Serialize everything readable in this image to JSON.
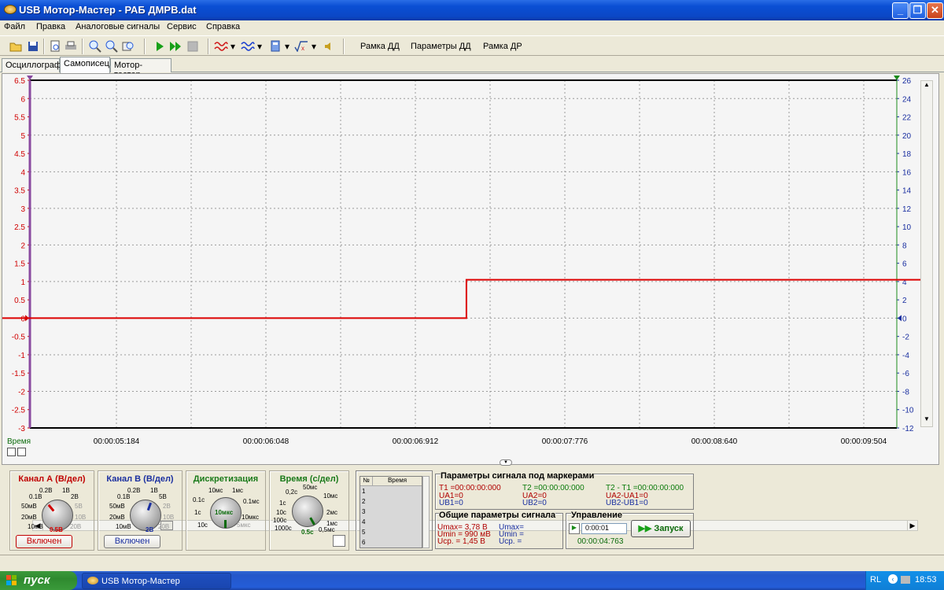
{
  "window": {
    "title": "USB Мотор-Мастер - РАБ ДМРВ.dat",
    "btn_min": "_",
    "btn_max": "❐",
    "btn_close": "✕"
  },
  "menu": [
    "Файл",
    "Правка",
    "Аналоговые сигналы",
    "Сервис",
    "Справка"
  ],
  "toolbar": {
    "labels": [
      "Рамка ДД",
      "Параметры ДД",
      "Рамка ДР"
    ]
  },
  "tabs": [
    "Осциллограф",
    "Самописец",
    "Мотор-тестер"
  ],
  "chart_data": {
    "type": "line",
    "x_label": "Время",
    "x_ticks": [
      "00:00:05:184",
      "00:00:06:048",
      "00:00:06:912",
      "00:00:07:776",
      "00:00:08:640",
      "00:00:09:504"
    ],
    "ylim_left": [
      -3,
      6.5
    ],
    "y_ticks_left": [
      "6.5",
      "6",
      "5.5",
      "5",
      "4.5",
      "4",
      "3.5",
      "3",
      "2.5",
      "2",
      "1.5",
      "1",
      "0.5",
      "0",
      "-0.5",
      "-1",
      "-1.5",
      "-2",
      "-2.5",
      "-3"
    ],
    "ylim_right": [
      -12,
      26
    ],
    "y_ticks_right": [
      "26",
      "24",
      "22",
      "20",
      "18",
      "16",
      "14",
      "12",
      "10",
      "8",
      "6",
      "4",
      "2",
      "0",
      "-2",
      "-4",
      "-6",
      "-8",
      "-10",
      "-12"
    ],
    "grid": true,
    "series": [
      {
        "color": "#dd0000",
        "points": [
          {
            "x": "00:00:04:9",
            "y": 0
          },
          {
            "x": "00:00:07:207",
            "y": 0
          },
          {
            "x": "00:00:07:207",
            "y": 1.05
          },
          {
            "x": "00:00:09:904",
            "y": 1.05
          }
        ]
      }
    ]
  },
  "channel_a": {
    "title": "Канал А (В/дел)",
    "labels": [
      "0.2В",
      "1В",
      "0.1В",
      "2В",
      "50мВ",
      "5В",
      "20мВ",
      "10В",
      "10мВ",
      "20В"
    ],
    "value": "0.5В",
    "button": "Включен"
  },
  "channel_b": {
    "title": "Канал В (В/дел)",
    "labels": [
      "0.2В",
      "1В",
      "0.1В",
      "5В",
      "50мВ",
      "2В",
      "20мВ",
      "10В",
      "10мВ",
      "20В"
    ],
    "value": "2В",
    "button": "Включен"
  },
  "discret": {
    "title": "Дискретизация",
    "labels": [
      "10мс",
      "1мс",
      "0.1с",
      "0.1мс",
      "1с",
      "10мкс",
      "10с",
      "5мкс"
    ],
    "value": "10мкс"
  },
  "time": {
    "title": "Время (с/дел)",
    "labels": [
      "50мс",
      "0,2с",
      "10мс",
      "1с",
      "2мс",
      "10с",
      "1мс",
      "100с",
      "0,5мс",
      "1000с"
    ],
    "value": "0.5с"
  },
  "table": {
    "col_num": "№",
    "col_time": "Время",
    "rows": [
      "1",
      "2",
      "3",
      "4",
      "5",
      "6"
    ]
  },
  "markers": {
    "title": "Параметры сигнала под маркерами",
    "t1": "T1 =00:00:00:000",
    "ua1": "UA1=0",
    "ub1": "UB1=0",
    "t2": "T2 =00:00:00:000",
    "ua2": "UA2=0",
    "ub2": "UB2=0",
    "dt": "T2 - T1 =00:00:00:000",
    "dua": "UA2-UA1=0",
    "dub": "UB2-UB1=0"
  },
  "general": {
    "title": "Общие параметры сигнала",
    "umax_a": "Umax= 3,78 В",
    "umin_a": "Umin = 990 мВ",
    "ucp_a": "Ucp. = 1,45 В",
    "umax_b": "Umax=",
    "umin_b": "Umin =",
    "ucp_b": "Ucp. ="
  },
  "control": {
    "title": "Управление",
    "spin": "0:00:01",
    "elapsed": "00:00:04:763",
    "start": "Запуск"
  },
  "taskbar": {
    "start": "пуск",
    "task": "USB Мотор-Мастер",
    "lang": "RL",
    "clock": "18:53"
  }
}
